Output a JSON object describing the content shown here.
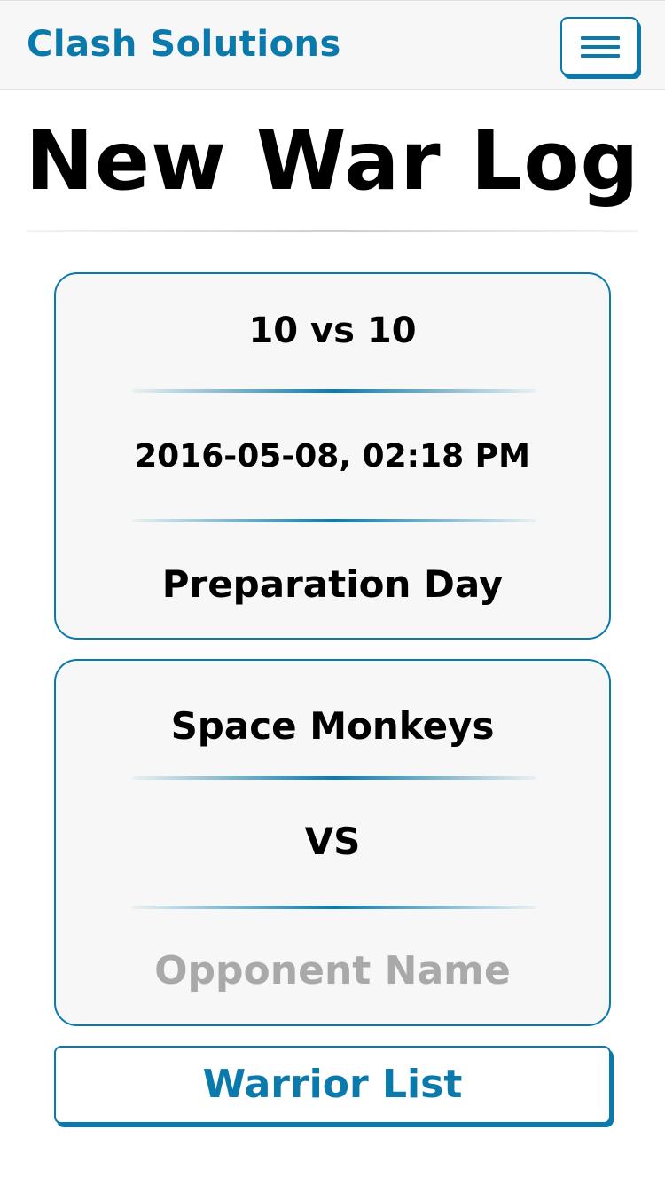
{
  "navbar": {
    "brand": "Clash Solutions",
    "menu_icon": "hamburger-menu-icon"
  },
  "page": {
    "title": "New War Log"
  },
  "war_info": {
    "size": "10 vs 10",
    "datetime": "2016-05-08, 02:18 PM",
    "phase": "Preparation Day"
  },
  "matchup": {
    "clan_name": "Space Monkeys",
    "versus": "VS",
    "opponent_placeholder": "Opponent Name"
  },
  "actions": {
    "warrior_list_label": "Warrior List"
  },
  "colors": {
    "accent": "#0a7aad",
    "card_background": "#f7f7f7",
    "placeholder_text": "#a9a9a9"
  }
}
